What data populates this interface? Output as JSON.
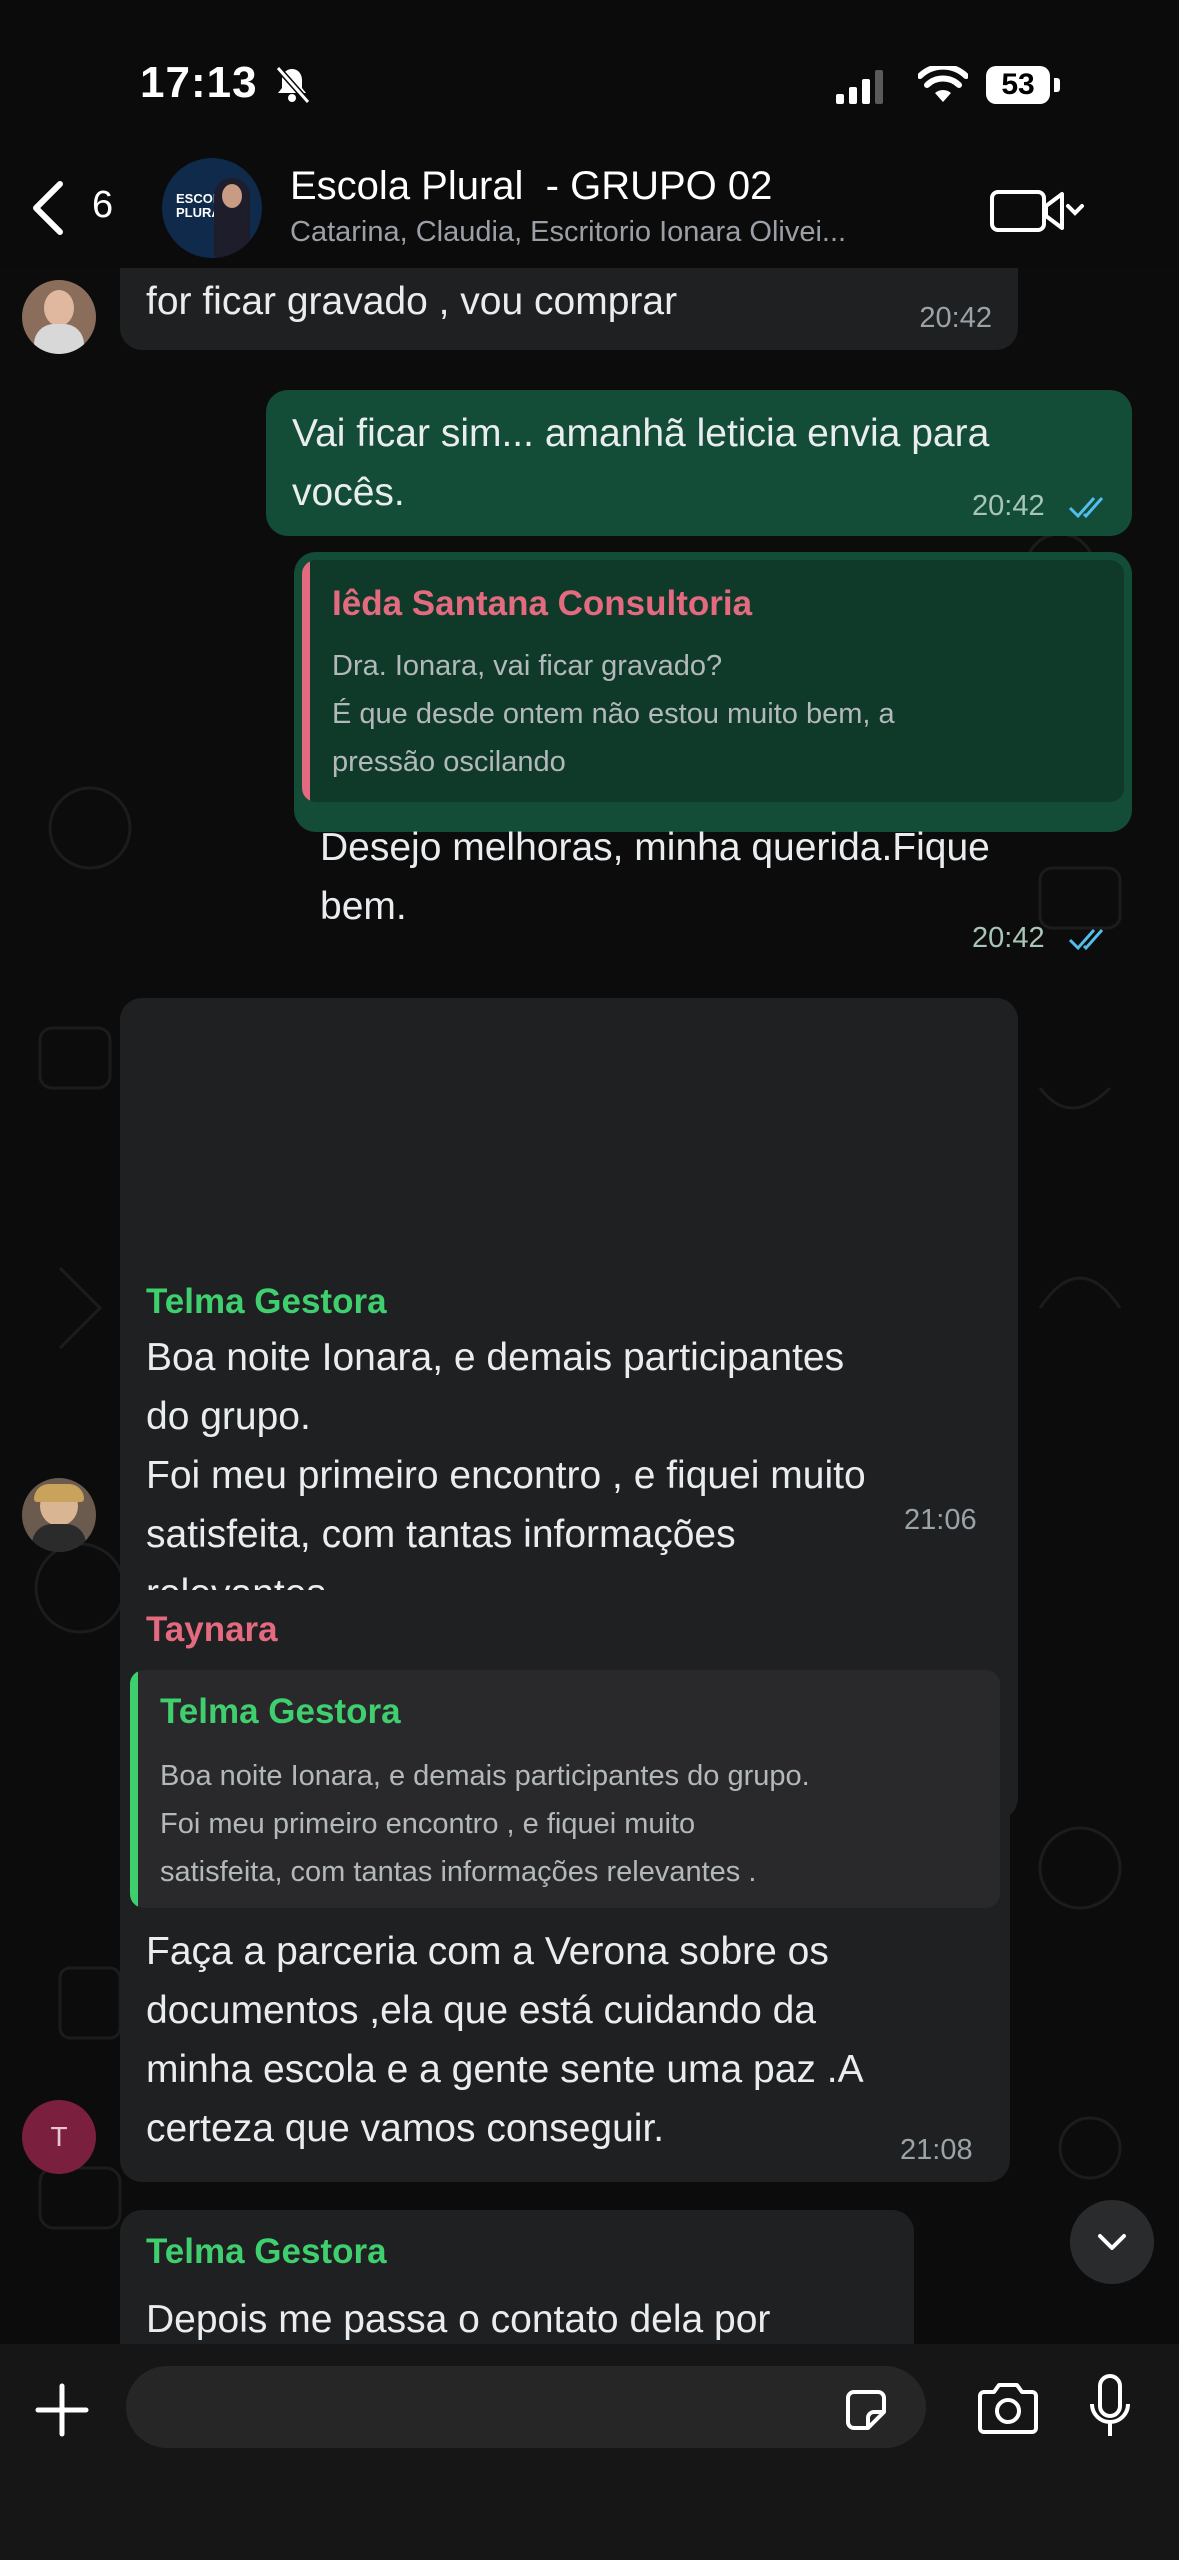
{
  "status_bar": {
    "time": "17:13",
    "battery": "53"
  },
  "header": {
    "back_count": "6",
    "title": "Escola Plural  - GRUPO 02",
    "members": "Catarina, Claudia, Escritorio Ionara Olivei...",
    "avatar_text": "ESCOLA\nPLURAL"
  },
  "messages": [
    {
      "text": "for ficar gravado , vou comprar",
      "time": "20:42"
    },
    {
      "text": "Vai ficar sim... amanhã leticia envia para\nvocês.",
      "time": "20:42"
    },
    {
      "quote_name": "Iêda Santana Consultoria",
      "quote_text": "Dra. Ionara, vai ficar gravado?\nÉ que desde ontem não estou muito bem, a\npressão oscilando",
      "text": "Desejo melhoras, minha querida.Fique\nbem.",
      "time": "20:42"
    },
    {
      "sender": "Telma Gestora",
      "text": "Boa noite Ionara, e demais participantes\ndo grupo.\nFoi meu primeiro encontro , e fiquei muito\nsatisfeita, com tantas informações\nrelevantes .\nJá vi que preciso atualizar alguns\ndocumentos.\nObrigada .",
      "time": "21:06"
    },
    {
      "sender": "Taynara",
      "quote_name": "Telma Gestora",
      "quote_text": "Boa noite Ionara, e demais participantes do grupo.\nFoi meu primeiro encontro , e fiquei muito\nsatisfeita, com tantas informações relevantes .",
      "text": "Faça a parceria com a Verona sobre os\ndocumentos ,ela que está cuidando da\nminha escola e a gente sente uma paz .A\ncerteza que vamos conseguir.",
      "time": "21:08",
      "avatar_initial": "T"
    },
    {
      "sender": "Telma Gestora",
      "text": "Depois me passa o contato dela por"
    }
  ],
  "input": {
    "placeholder": ""
  },
  "colors": {
    "outgoing_bubble": "#144d37",
    "incoming_bubble": "#1f2022",
    "sender_green": "#3fcf6e",
    "sender_pink": "#e46b7f",
    "read_ticks": "#53bdeb"
  },
  "icons": [
    "back-icon",
    "mute-icon",
    "signal-icon",
    "wifi-icon",
    "video-call-icon",
    "double-check-icon",
    "plus-icon",
    "sticker-icon",
    "camera-icon",
    "mic-icon",
    "chevron-down-icon"
  ]
}
